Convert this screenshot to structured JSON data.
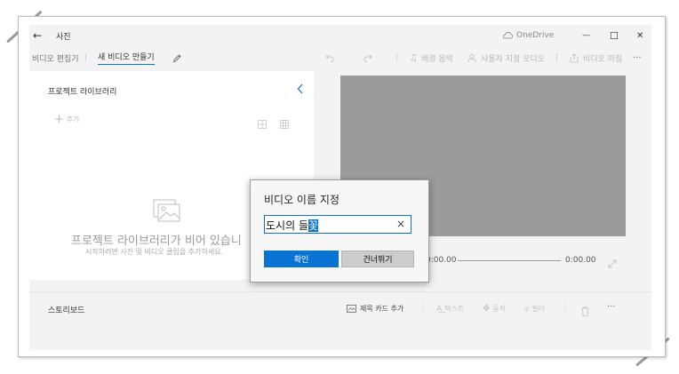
{
  "window": {
    "app_title": "사진",
    "onedrive_label": "OneDrive",
    "back_glyph": "←",
    "minimize_glyph": "—",
    "maximize_glyph": "☐",
    "close_glyph": "✕"
  },
  "nav": {
    "breadcrumb_parent": "비디오 편집기",
    "breadcrumb_current": "새 비디오 만들기",
    "background_music": "배경 음악",
    "custom_audio": "사용자 지정 오디오",
    "finish_video": "비디오 마침",
    "more_glyph": "···"
  },
  "library": {
    "title": "프로젝트 라이브러리",
    "add_label": "추가",
    "empty_title": "프로젝트 라이브러리가 비어 있습니",
    "empty_subtitle": "시작하려면 사진 및 비디오 클립을 추가하세요."
  },
  "player": {
    "current_time": "0:00.00",
    "total_time": "0:00.00"
  },
  "storyboard": {
    "title": "스토리보드",
    "title_card": "제목 카드 추가",
    "text": "텍스트",
    "motion": "동작",
    "filter": "필터",
    "more_glyph": "···"
  },
  "dialog": {
    "title": "비디오 이름 지정",
    "input_value_plain": "도시의 들",
    "input_value_selected": "꽃",
    "clear_glyph": "×",
    "ok_label": "확인",
    "skip_label": "건너뛰기"
  },
  "colors": {
    "accent": "#0a74d4",
    "preview_gray": "#9b9b9b",
    "dialog_border": "#9c9c9c"
  }
}
